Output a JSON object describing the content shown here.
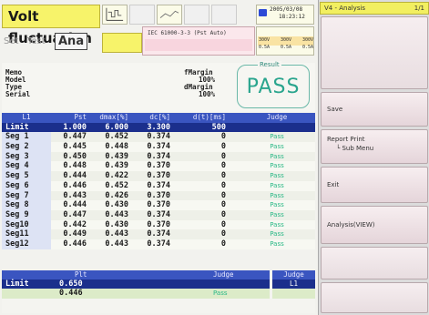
{
  "header": {
    "title": "Volt fluctuation",
    "modes": [
      "Set",
      "Test",
      "Ana"
    ],
    "active_mode": "Ana",
    "standard": "IEC 61000-3-3 (Pst Auto)",
    "date": "2005/03/08",
    "time": "18:23:12",
    "ranges": {
      "voltage": [
        "300V",
        "300V",
        "300V"
      ],
      "current": [
        "0.5A",
        "0.5A",
        "0.5A"
      ]
    }
  },
  "info": {
    "labels": [
      "Memo",
      "Model",
      "Type",
      "Serial"
    ],
    "margin_rows": [
      {
        "label": "fMargin",
        "value": "100%"
      },
      {
        "label": "dMargin",
        "value": "100%"
      }
    ],
    "result_title": "Result",
    "result_value": "PASS"
  },
  "table": {
    "headers": [
      "L1",
      "Pst",
      "dmax[%]",
      "dc[%]",
      "d(t)[ms]",
      "Judge"
    ],
    "limit": [
      "Limit",
      "1.000",
      "6.000",
      "3.300",
      "500",
      ""
    ],
    "rows": [
      [
        "Seg 1",
        "0.447",
        "0.452",
        "0.374",
        "0",
        "Pass"
      ],
      [
        "Seg 2",
        "0.445",
        "0.448",
        "0.374",
        "0",
        "Pass"
      ],
      [
        "Seg 3",
        "0.450",
        "0.439",
        "0.374",
        "0",
        "Pass"
      ],
      [
        "Seg 4",
        "0.448",
        "0.439",
        "0.370",
        "0",
        "Pass"
      ],
      [
        "Seg 5",
        "0.444",
        "0.422",
        "0.370",
        "0",
        "Pass"
      ],
      [
        "Seg 6",
        "0.446",
        "0.452",
        "0.374",
        "0",
        "Pass"
      ],
      [
        "Seg 7",
        "0.443",
        "0.426",
        "0.370",
        "0",
        "Pass"
      ],
      [
        "Seg 8",
        "0.444",
        "0.430",
        "0.370",
        "0",
        "Pass"
      ],
      [
        "Seg 9",
        "0.447",
        "0.443",
        "0.374",
        "0",
        "Pass"
      ],
      [
        "Seg10",
        "0.442",
        "0.430",
        "0.370",
        "0",
        "Pass"
      ],
      [
        "Seg11",
        "0.449",
        "0.443",
        "0.374",
        "0",
        "Pass"
      ],
      [
        "Seg12",
        "0.446",
        "0.443",
        "0.374",
        "0",
        "Pass"
      ]
    ]
  },
  "pit": {
    "header": "Plt",
    "judge_header": "Judge",
    "limit_label": "Limit",
    "limit_value": "0.650",
    "value": "0.446",
    "judge": "Pass",
    "judge_col_header": "Judge",
    "judge_col_phase": "L1"
  },
  "panel": {
    "title": "V4 - Analysis",
    "page": "1/1",
    "buttons": [
      "Save",
      "Report Print",
      "Exit",
      "Analysis(VIEW)"
    ],
    "report_sub": "Sub Menu"
  },
  "colors": {
    "title_bg": "#f7f36a",
    "table_header": "#3a55c0",
    "limit_row": "#1b2f8c",
    "pass_green": "#2ab886"
  }
}
